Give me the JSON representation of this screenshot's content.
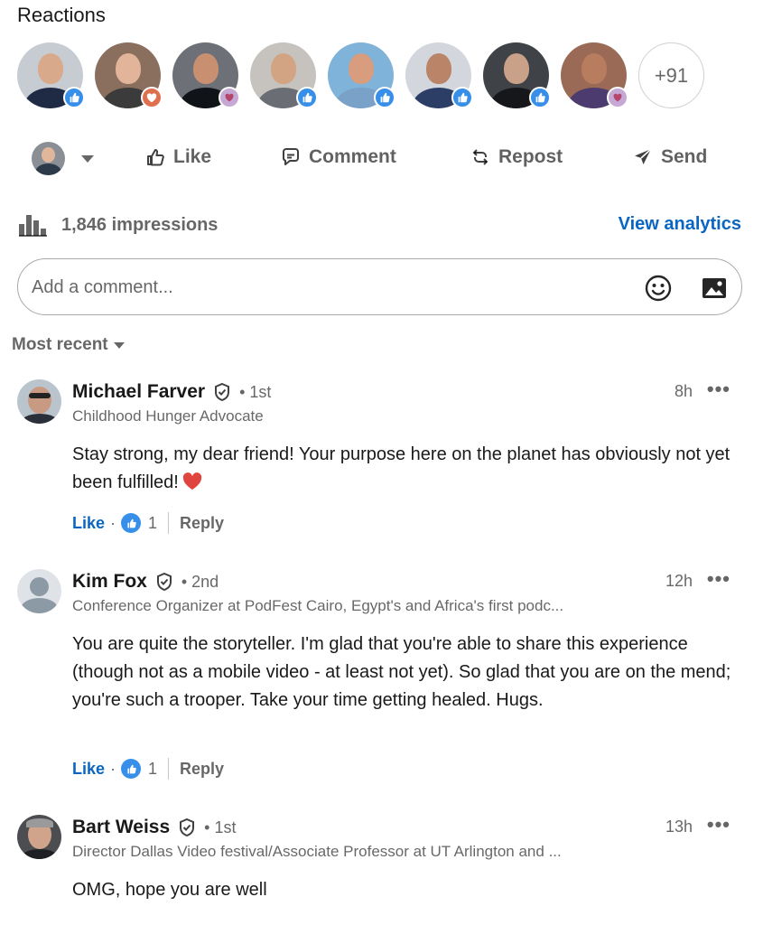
{
  "reactions": {
    "title": "Reactions",
    "avatars": [
      {
        "name": "reactor-1",
        "reaction": "like"
      },
      {
        "name": "reactor-2",
        "reaction": "love"
      },
      {
        "name": "reactor-3",
        "reaction": "support"
      },
      {
        "name": "reactor-4",
        "reaction": "like"
      },
      {
        "name": "reactor-5",
        "reaction": "like"
      },
      {
        "name": "reactor-6",
        "reaction": "like"
      },
      {
        "name": "reactor-7",
        "reaction": "like"
      },
      {
        "name": "reactor-8",
        "reaction": "support"
      }
    ],
    "more_label": "+91"
  },
  "actions": {
    "like": "Like",
    "comment": "Comment",
    "repost": "Repost",
    "send": "Send"
  },
  "stats": {
    "impressions": "1,846 impressions",
    "view_analytics": "View analytics"
  },
  "comment_box": {
    "placeholder": "Add a comment..."
  },
  "sort": {
    "label": "Most recent"
  },
  "comments": [
    {
      "name": "Michael Farver",
      "degree": "• 1st",
      "headline": "Childhood Hunger Advocate",
      "time": "8h",
      "more": "•••",
      "text": "Stay strong, my dear friend! Your purpose here on the planet has obviously not yet been fulfilled!",
      "like_label": "Like",
      "dot": "·",
      "like_count": "1",
      "reply_label": "Reply"
    },
    {
      "name": "Kim Fox",
      "degree": "• 2nd",
      "headline": "Conference Organizer at PodFest Cairo, Egypt's and Africa's first podc...",
      "time": "12h",
      "more": "•••",
      "text": "You are quite the storyteller. I'm glad that you're able to share this experience (though not as a mobile video - at least not yet). So glad that you are on the mend; you're such a trooper. Take your time getting healed. Hugs.",
      "like_label": "Like",
      "dot": "·",
      "like_count": "1",
      "reply_label": "Reply"
    },
    {
      "name": "Bart Weiss",
      "degree": "• 1st",
      "headline": "Director Dallas Video festival/Associate Professor at UT Arlington and ...",
      "time": "13h",
      "more": "•••",
      "text": "OMG, hope you are well"
    }
  ],
  "colors": {
    "link_blue": "#0a66c2",
    "like_blue": "#378fe9",
    "love_orange": "#df704d",
    "support_purple": "#c5a8d3"
  }
}
